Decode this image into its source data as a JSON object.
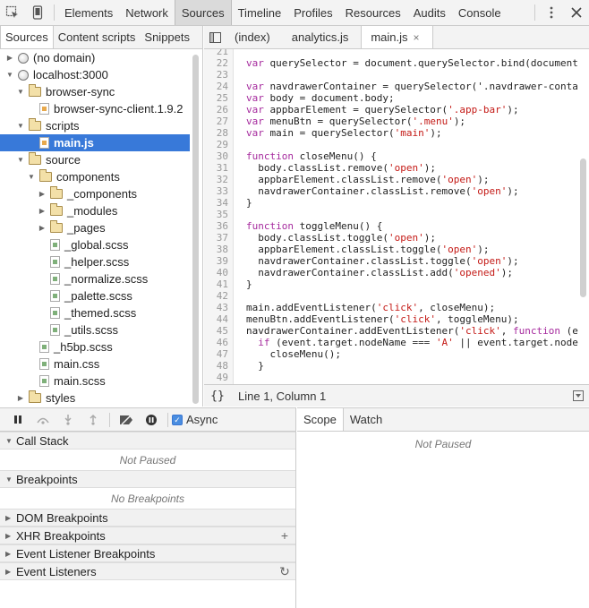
{
  "toolbar": {
    "tabs": [
      "Elements",
      "Network",
      "Sources",
      "Timeline",
      "Profiles",
      "Resources",
      "Audits",
      "Console"
    ],
    "active_tab": "Sources"
  },
  "navigator": {
    "tabs": [
      "Sources",
      "Content scripts",
      "Snippets"
    ],
    "active_tab": "Sources",
    "tree": [
      {
        "label": "(no domain)",
        "depth": 0,
        "icon": "globe-icon",
        "expanded": false
      },
      {
        "label": "localhost:3000",
        "depth": 0,
        "icon": "globe-icon",
        "expanded": true
      },
      {
        "label": "browser-sync",
        "depth": 1,
        "icon": "folder-icon",
        "expanded": true
      },
      {
        "label": "browser-sync-client.1.9.2",
        "depth": 2,
        "icon": "js-file-icon",
        "expanded": null
      },
      {
        "label": "scripts",
        "depth": 1,
        "icon": "folder-icon",
        "expanded": true
      },
      {
        "label": "main.js",
        "depth": 2,
        "icon": "js-file-icon",
        "expanded": null,
        "selected": true
      },
      {
        "label": "source",
        "depth": 1,
        "icon": "folder-icon",
        "expanded": true
      },
      {
        "label": "components",
        "depth": 2,
        "icon": "folder-icon",
        "expanded": true
      },
      {
        "label": "_components",
        "depth": 3,
        "icon": "folder-icon",
        "expanded": false
      },
      {
        "label": "_modules",
        "depth": 3,
        "icon": "folder-icon",
        "expanded": false
      },
      {
        "label": "_pages",
        "depth": 3,
        "icon": "folder-icon",
        "expanded": false
      },
      {
        "label": "_global.scss",
        "depth": 3,
        "icon": "css-file-icon",
        "expanded": null
      },
      {
        "label": "_helper.scss",
        "depth": 3,
        "icon": "css-file-icon",
        "expanded": null
      },
      {
        "label": "_normalize.scss",
        "depth": 3,
        "icon": "css-file-icon",
        "expanded": null
      },
      {
        "label": "_palette.scss",
        "depth": 3,
        "icon": "css-file-icon",
        "expanded": null
      },
      {
        "label": "_themed.scss",
        "depth": 3,
        "icon": "css-file-icon",
        "expanded": null
      },
      {
        "label": "_utils.scss",
        "depth": 3,
        "icon": "css-file-icon",
        "expanded": null
      },
      {
        "label": "_h5bp.scss",
        "depth": 2,
        "icon": "css-file-icon",
        "expanded": null
      },
      {
        "label": "main.css",
        "depth": 2,
        "icon": "css-file-icon",
        "expanded": null
      },
      {
        "label": "main.scss",
        "depth": 2,
        "icon": "css-file-icon",
        "expanded": null
      },
      {
        "label": "styles",
        "depth": 1,
        "icon": "folder-icon",
        "expanded": false
      }
    ]
  },
  "editor": {
    "tabs": [
      {
        "label": "(index)",
        "active": false
      },
      {
        "label": "analytics.js",
        "active": false
      },
      {
        "label": "main.js",
        "active": true
      }
    ],
    "lines": [
      {
        "n": "21",
        "text": ""
      },
      {
        "n": "22",
        "text": "var querySelector = document.querySelector.bind(document"
      },
      {
        "n": "23",
        "text": ""
      },
      {
        "n": "24",
        "text": "var navdrawerContainer = querySelector('.navdrawer-conta"
      },
      {
        "n": "25",
        "text": "var body = document.body;"
      },
      {
        "n": "26",
        "text": "var appbarElement = querySelector('.app-bar');"
      },
      {
        "n": "27",
        "text": "var menuBtn = querySelector('.menu');"
      },
      {
        "n": "28",
        "text": "var main = querySelector('main');"
      },
      {
        "n": "29",
        "text": ""
      },
      {
        "n": "30",
        "text": "function closeMenu() {"
      },
      {
        "n": "31",
        "text": "  body.classList.remove('open');"
      },
      {
        "n": "32",
        "text": "  appbarElement.classList.remove('open');"
      },
      {
        "n": "33",
        "text": "  navdrawerContainer.classList.remove('open');"
      },
      {
        "n": "34",
        "text": "}"
      },
      {
        "n": "35",
        "text": ""
      },
      {
        "n": "36",
        "text": "function toggleMenu() {"
      },
      {
        "n": "37",
        "text": "  body.classList.toggle('open');"
      },
      {
        "n": "38",
        "text": "  appbarElement.classList.toggle('open');"
      },
      {
        "n": "39",
        "text": "  navdrawerContainer.classList.toggle('open');"
      },
      {
        "n": "40",
        "text": "  navdrawerContainer.classList.add('opened');"
      },
      {
        "n": "41",
        "text": "}"
      },
      {
        "n": "42",
        "text": ""
      },
      {
        "n": "43",
        "text": "main.addEventListener('click', closeMenu);"
      },
      {
        "n": "44",
        "text": "menuBtn.addEventListener('click', toggleMenu);"
      },
      {
        "n": "45",
        "text": "navdrawerContainer.addEventListener('click', function (e"
      },
      {
        "n": "46",
        "text": "  if (event.target.nodeName === 'A' || event.target.node"
      },
      {
        "n": "47",
        "text": "    closeMenu();"
      },
      {
        "n": "48",
        "text": "  }"
      },
      {
        "n": "49",
        "text": ""
      }
    ],
    "braces": "{}",
    "cursor_position": "Line 1, Column 1"
  },
  "debugger": {
    "async_label": "Async",
    "async_checked": true,
    "sections": [
      {
        "title": "Call Stack",
        "expanded": true,
        "body": "Not Paused"
      },
      {
        "title": "Breakpoints",
        "expanded": true,
        "body": "No Breakpoints"
      },
      {
        "title": "DOM Breakpoints",
        "expanded": false
      },
      {
        "title": "XHR Breakpoints",
        "expanded": false,
        "action": "+"
      },
      {
        "title": "Event Listener Breakpoints",
        "expanded": false
      },
      {
        "title": "Event Listeners",
        "expanded": false,
        "action": "↻"
      }
    ]
  },
  "scope": {
    "tabs": [
      "Scope",
      "Watch"
    ],
    "active_tab": "Scope",
    "body": "Not Paused"
  },
  "colors": {
    "selection": "#3879d9",
    "keyword": "#a62b9e",
    "string": "#c41a16"
  }
}
